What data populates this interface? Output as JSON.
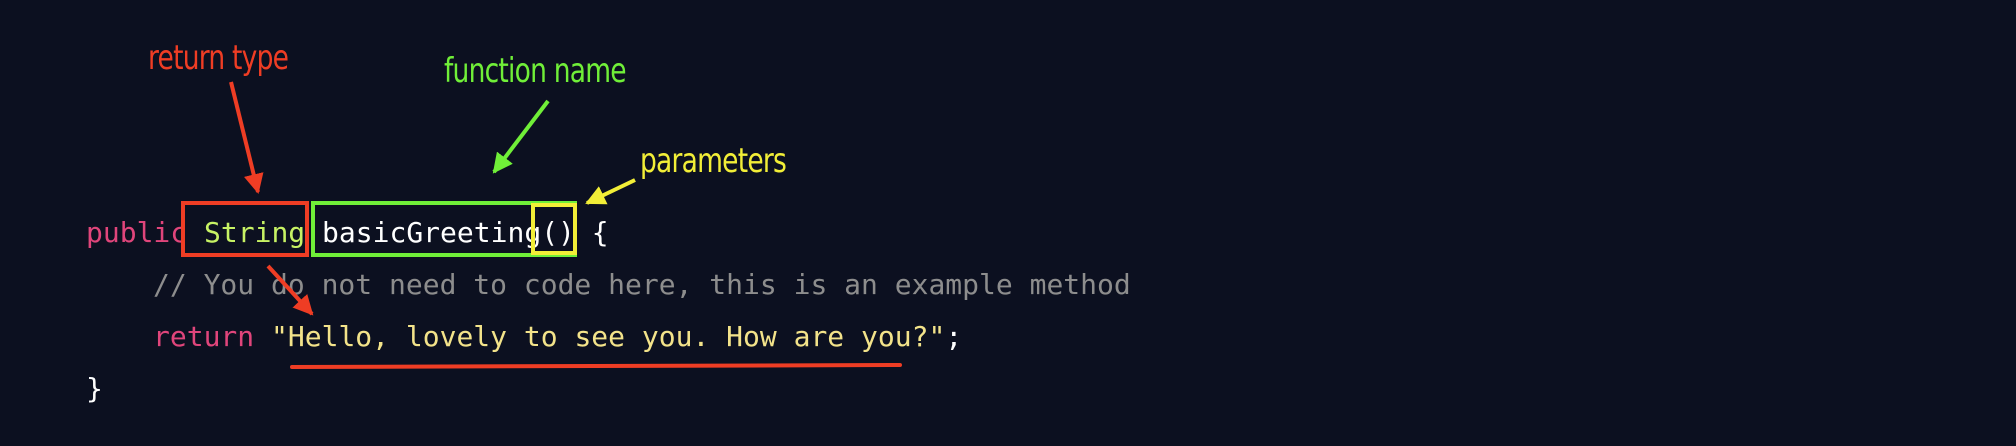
{
  "annotations": {
    "return_type": "return type",
    "function_name": "function name",
    "parameters": "parameters"
  },
  "code": {
    "line1": {
      "keyword": "public",
      "type": "String",
      "function_name": "basicGreeting",
      "parens": "()",
      "brace": " {"
    },
    "line2": {
      "comment": "// You do not need to code here, this is an example method"
    },
    "line3": {
      "keyword": "return",
      "string": "\"Hello, lovely to see you. How are you?\"",
      "semicolon": ";"
    },
    "line4": {
      "brace": "}"
    }
  },
  "colors": {
    "background": "#0c1020",
    "return_type_annotation": "#ef3d24",
    "function_name_annotation": "#70ef38",
    "parameters_annotation": "#f2ee37",
    "keyword": "#e0457b",
    "type": "#c7f264",
    "comment": "#8d8d8d",
    "string": "#f3e38a"
  }
}
